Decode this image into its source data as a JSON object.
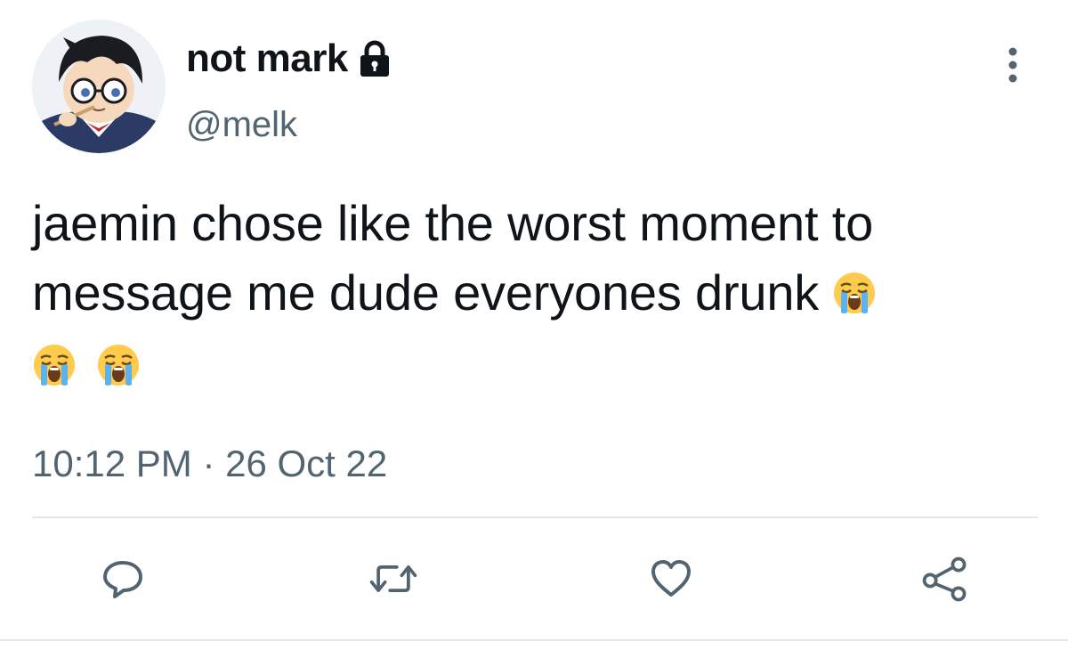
{
  "tweet": {
    "display_name": "not mark",
    "protected_icon": "lock-icon",
    "handle": "@melk",
    "text": "jaemin chose like the worst moment to message me dude everyones drunk",
    "emoji_name": "loudly-crying-face-emoji",
    "emoji_count": 3,
    "time": "10:12 PM",
    "separator": "·",
    "date": "26 Oct 22",
    "more_icon": "more-vertical-icon"
  },
  "actions": {
    "reply_icon": "reply-icon",
    "retweet_icon": "retweet-icon",
    "like_icon": "heart-icon",
    "share_icon": "share-icon"
  },
  "colors": {
    "text": "#0f1419",
    "secondary": "#536471",
    "divider": "#e1e8ed"
  }
}
